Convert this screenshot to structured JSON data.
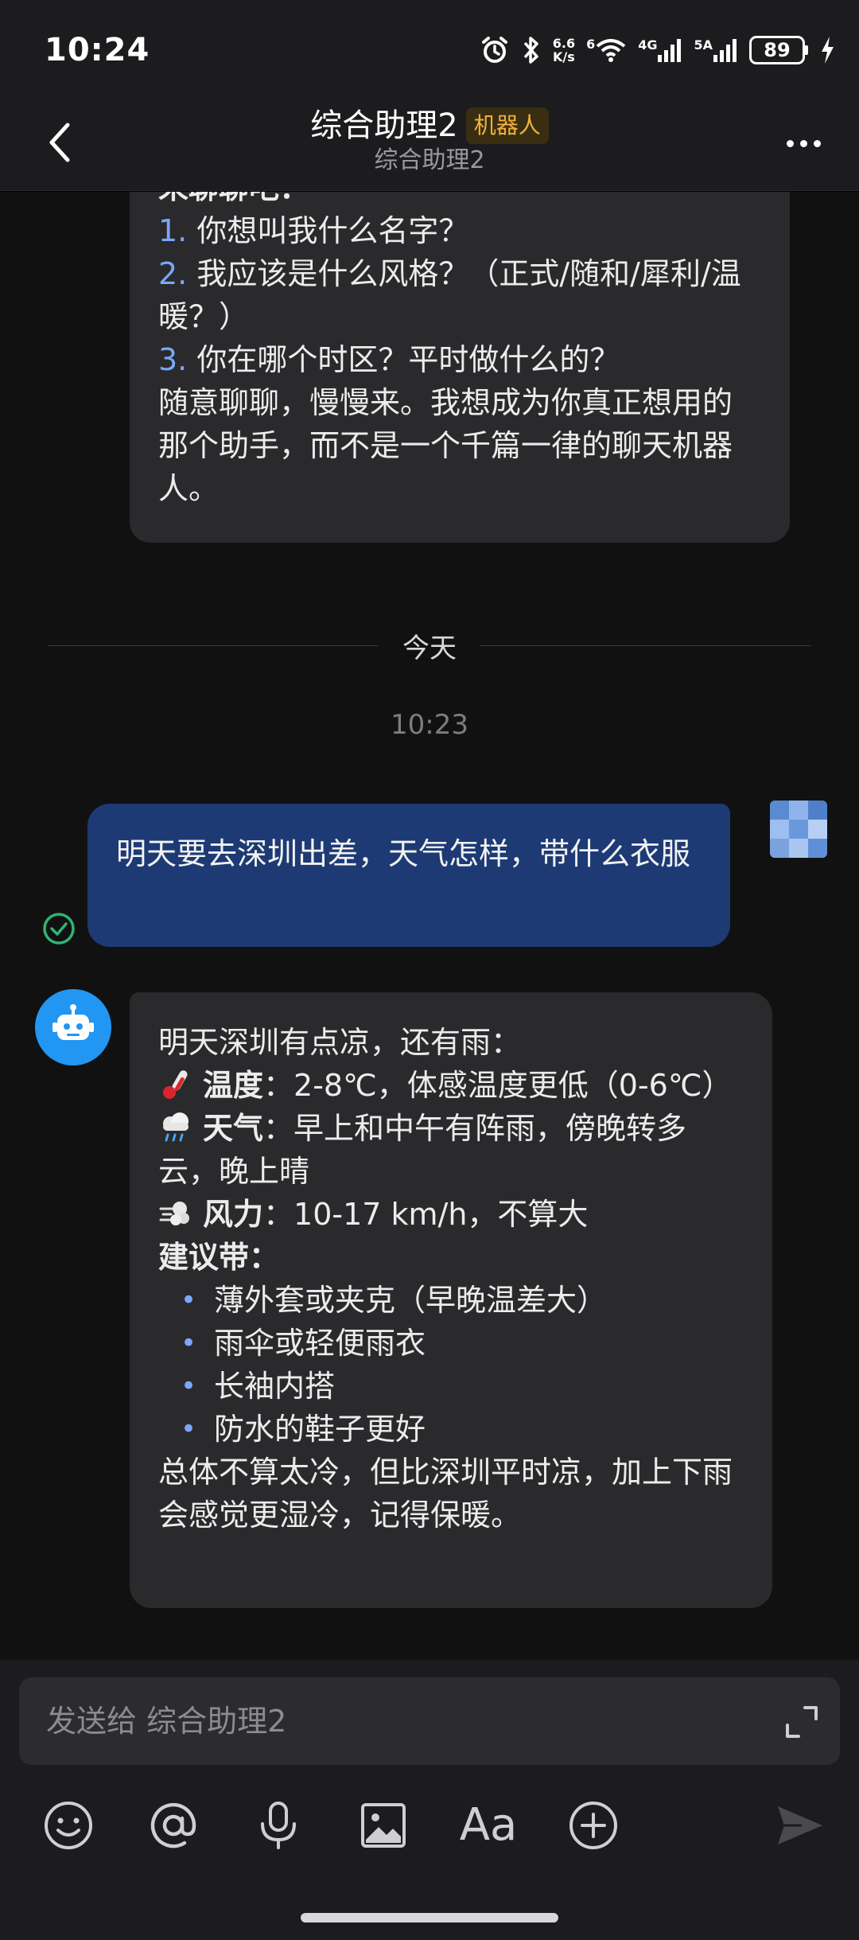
{
  "status_bar": {
    "time": "10:24",
    "net_speed_top": "6.6",
    "net_speed_bottom": "K/s",
    "wifi_label": "6",
    "cell1_label": "4G",
    "cell2_label": "5A",
    "battery": "89"
  },
  "header": {
    "title": "综合助理2",
    "badge": "机器人",
    "subtitle": "综合助理2"
  },
  "messages": {
    "bot_top": {
      "line_cut": "来聊聊吧：",
      "q1_num": "1.",
      "q1": "你想叫我什么名字？",
      "q2_num": "2.",
      "q2": "我应该是什么风格？（正式/随和/犀利/温暖？）",
      "q3_num": "3.",
      "q3": "你在哪个时区？平时做什么的？",
      "tail": "随意聊聊，慢慢来。我想成为你真正想用的那个助手，而不是一个千篇一律的聊天机器人。"
    },
    "divider_label": "今天",
    "timestamp": "10:23",
    "user": {
      "text": "明天要去深圳出差，天气怎样，带什么衣服"
    },
    "bot": {
      "intro": "明天深圳有点凉，还有雨：",
      "temp_label": "温度",
      "temp_value": "：2-8℃，体感温度更低（0-6℃）",
      "weather_label": "天气",
      "weather_value": "：早上和中午有阵雨，傍晚转多云，晚上晴",
      "wind_label": "风力",
      "wind_value": "：10-17 km/h，不算大",
      "advice_label": "建议带：",
      "items": [
        "薄外套或夹克（早晚温差大）",
        "雨伞或轻便雨衣",
        "长袖内搭",
        "防水的鞋子更好"
      ],
      "summary": "总体不算太冷，但比深圳平时凉，加上下雨会感觉更湿冷，记得保暖。"
    }
  },
  "input": {
    "placeholder": "发送给 综合助理2"
  },
  "toolbar": {
    "font_label": "Aa"
  },
  "colors": {
    "user_bubble": "#1d3a74",
    "bot_bubble": "#2a2a2c",
    "badge_text": "#f2b23a",
    "accent": "#7ba7ff",
    "bot_avatar": "#2196f3",
    "read_check": "#2bb673"
  }
}
